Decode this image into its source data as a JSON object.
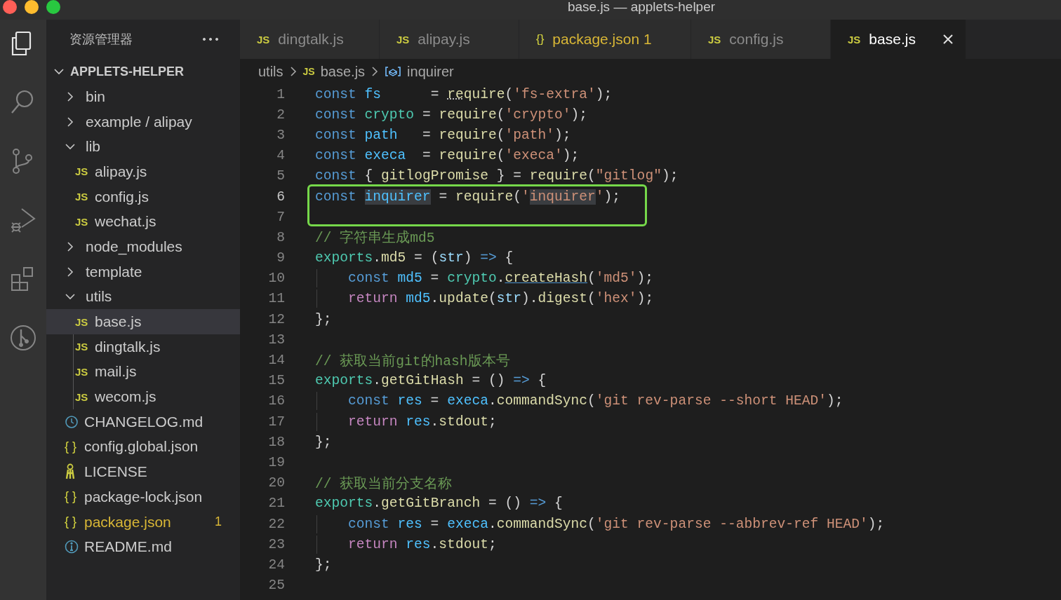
{
  "window": {
    "title": "base.js — applets-helper"
  },
  "activity_bar": [
    {
      "kind": "files",
      "selected": true
    },
    {
      "kind": "search",
      "selected": false
    },
    {
      "kind": "source-control",
      "selected": false
    },
    {
      "kind": "run-debug",
      "selected": false
    },
    {
      "kind": "extensions",
      "selected": false
    },
    {
      "kind": "git-graph",
      "selected": false
    }
  ],
  "explorer": {
    "title": "资源管理器",
    "root": {
      "label": "APPLETS-HELPER",
      "expanded": true,
      "children": [
        {
          "label": "bin",
          "kind": "folder",
          "expanded": false,
          "selected": false,
          "warning": false
        },
        {
          "label": "example / alipay",
          "kind": "folder",
          "expanded": false,
          "selected": false,
          "warning": false
        },
        {
          "label": "lib",
          "kind": "folder",
          "expanded": true,
          "selected": false,
          "warning": false,
          "children": [
            {
              "label": "alipay.js",
              "kind": "js",
              "icon": "JS",
              "selected": false,
              "warning": false
            },
            {
              "label": "config.js",
              "kind": "js",
              "icon": "JS",
              "selected": false,
              "warning": false
            },
            {
              "label": "wechat.js",
              "kind": "js",
              "icon": "JS",
              "selected": false,
              "warning": false
            }
          ]
        },
        {
          "label": "node_modules",
          "kind": "folder",
          "expanded": false,
          "selected": false,
          "warning": false
        },
        {
          "label": "template",
          "kind": "folder",
          "expanded": false,
          "selected": false,
          "warning": false
        },
        {
          "label": "utils",
          "kind": "folder",
          "expanded": true,
          "selected": false,
          "warning": false,
          "children": [
            {
              "label": "base.js",
              "kind": "js",
              "icon": "JS",
              "selected": true,
              "warning": false
            },
            {
              "label": "dingtalk.js",
              "kind": "js",
              "icon": "JS",
              "selected": false,
              "warning": false
            },
            {
              "label": "mail.js",
              "kind": "js",
              "icon": "JS",
              "selected": false,
              "warning": false
            },
            {
              "label": "wecom.js",
              "kind": "js",
              "icon": "JS",
              "selected": false,
              "warning": false
            }
          ]
        },
        {
          "label": "CHANGELOG.md",
          "kind": "changelog",
          "selected": false,
          "warning": false
        },
        {
          "label": "config.global.json",
          "kind": "json",
          "icon": "{ }",
          "selected": false,
          "warning": false
        },
        {
          "label": "LICENSE",
          "kind": "license",
          "selected": false,
          "warning": false
        },
        {
          "label": "package-lock.json",
          "kind": "json",
          "icon": "{ }",
          "selected": false,
          "warning": false
        },
        {
          "label": "package.json",
          "kind": "json",
          "icon": "{ }",
          "selected": false,
          "warning": true,
          "badge": "1"
        },
        {
          "label": "README.md",
          "kind": "readme",
          "selected": false,
          "warning": false
        }
      ]
    }
  },
  "tabs": [
    {
      "label": "dingtalk.js",
      "icon": "JS",
      "kind": "js",
      "selected": false,
      "warning": false
    },
    {
      "label": "alipay.js",
      "icon": "JS",
      "kind": "js",
      "selected": false,
      "warning": false
    },
    {
      "label": "package.json",
      "icon": "{}",
      "kind": "json",
      "selected": false,
      "warning": true,
      "badge": "1"
    },
    {
      "label": "config.js",
      "icon": "JS",
      "kind": "js",
      "selected": false,
      "warning": false
    },
    {
      "label": "base.js",
      "icon": "JS",
      "kind": "js",
      "selected": true,
      "warning": false
    }
  ],
  "breadcrumb": [
    {
      "label": "utils",
      "kind": "folder"
    },
    {
      "label": "base.js",
      "kind": "file",
      "icon": "JS"
    },
    {
      "label": "inquirer",
      "kind": "symbol"
    }
  ],
  "code": [
    {
      "number": "1",
      "current": false,
      "boxed": false,
      "indented": false,
      "tokens": [
        {
          "kind": "kw",
          "text": "const "
        },
        {
          "kind": "var",
          "text": "fs"
        },
        {
          "kind": "p",
          "text": "      = "
        },
        {
          "kind": "hint",
          "text": "re"
        },
        {
          "kind": "fn",
          "text": "quire"
        },
        {
          "kind": "p",
          "text": "("
        },
        {
          "kind": "str",
          "text": "'fs-extra'"
        },
        {
          "kind": "p",
          "text": ");"
        }
      ]
    },
    {
      "number": "2",
      "current": false,
      "boxed": false,
      "indented": false,
      "tokens": [
        {
          "kind": "kw",
          "text": "const "
        },
        {
          "kind": "mod",
          "text": "crypto"
        },
        {
          "kind": "p",
          "text": " = "
        },
        {
          "kind": "fn",
          "text": "require"
        },
        {
          "kind": "p",
          "text": "("
        },
        {
          "kind": "str",
          "text": "'crypto'"
        },
        {
          "kind": "p",
          "text": ");"
        }
      ]
    },
    {
      "number": "3",
      "current": false,
      "boxed": false,
      "indented": false,
      "tokens": [
        {
          "kind": "kw",
          "text": "const "
        },
        {
          "kind": "var",
          "text": "path"
        },
        {
          "kind": "p",
          "text": "   = "
        },
        {
          "kind": "fn",
          "text": "require"
        },
        {
          "kind": "p",
          "text": "("
        },
        {
          "kind": "str",
          "text": "'path'"
        },
        {
          "kind": "p",
          "text": ");"
        }
      ]
    },
    {
      "number": "4",
      "current": false,
      "boxed": false,
      "indented": false,
      "tokens": [
        {
          "kind": "kw",
          "text": "const "
        },
        {
          "kind": "var",
          "text": "execa"
        },
        {
          "kind": "p",
          "text": "  = "
        },
        {
          "kind": "fn",
          "text": "require"
        },
        {
          "kind": "p",
          "text": "("
        },
        {
          "kind": "str",
          "text": "'execa'"
        },
        {
          "kind": "p",
          "text": ");"
        }
      ]
    },
    {
      "number": "5",
      "current": false,
      "boxed": false,
      "indented": false,
      "tokens": [
        {
          "kind": "kw",
          "text": "const "
        },
        {
          "kind": "p",
          "text": "{ "
        },
        {
          "kind": "fn",
          "text": "gitlogPromise"
        },
        {
          "kind": "p",
          "text": " } = "
        },
        {
          "kind": "fn",
          "text": "require"
        },
        {
          "kind": "p",
          "text": "("
        },
        {
          "kind": "str",
          "text": "\"gitlog\""
        },
        {
          "kind": "p",
          "text": ");"
        }
      ]
    },
    {
      "number": "6",
      "current": true,
      "boxed": true,
      "indented": false,
      "tokens": [
        {
          "kind": "kw",
          "text": "const "
        },
        {
          "kind": "match",
          "text": "inquirer"
        },
        {
          "kind": "p",
          "text": " = "
        },
        {
          "kind": "fn",
          "text": "require"
        },
        {
          "kind": "p",
          "text": "("
        },
        {
          "kind": "str",
          "text": "'"
        },
        {
          "kind": "matchstr",
          "text": "inquirer"
        },
        {
          "kind": "str",
          "text": "'"
        },
        {
          "kind": "p",
          "text": ");"
        }
      ]
    },
    {
      "number": "7",
      "current": false,
      "boxed": true,
      "indented": false
    },
    {
      "number": "8",
      "current": false,
      "boxed": false,
      "indented": false,
      "tokens": [
        {
          "kind": "cm",
          "text": "// 字符串生成md5"
        }
      ]
    },
    {
      "number": "9",
      "current": false,
      "boxed": false,
      "indented": false,
      "tokens": [
        {
          "kind": "mod",
          "text": "exports"
        },
        {
          "kind": "p",
          "text": "."
        },
        {
          "kind": "fn",
          "text": "md5"
        },
        {
          "kind": "p",
          "text": " = ("
        },
        {
          "kind": "param",
          "text": "str"
        },
        {
          "kind": "p",
          "text": ") "
        },
        {
          "kind": "kw",
          "text": "=>"
        },
        {
          "kind": "p",
          "text": " {"
        }
      ]
    },
    {
      "number": "10",
      "current": false,
      "boxed": false,
      "indented": true,
      "tokens": [
        {
          "kind": "kw",
          "text": "const "
        },
        {
          "kind": "var",
          "text": "md5"
        },
        {
          "kind": "p",
          "text": " = "
        },
        {
          "kind": "mod",
          "text": "crypto"
        },
        {
          "kind": "p",
          "text": "."
        },
        {
          "kind": "link",
          "text": "createHash"
        },
        {
          "kind": "p",
          "text": "("
        },
        {
          "kind": "str",
          "text": "'md5'"
        },
        {
          "kind": "p",
          "text": ");"
        }
      ]
    },
    {
      "number": "11",
      "current": false,
      "boxed": false,
      "indented": true,
      "tokens": [
        {
          "kind": "ret",
          "text": "return "
        },
        {
          "kind": "var",
          "text": "md5"
        },
        {
          "kind": "p",
          "text": "."
        },
        {
          "kind": "fn",
          "text": "update"
        },
        {
          "kind": "p",
          "text": "("
        },
        {
          "kind": "param",
          "text": "str"
        },
        {
          "kind": "p",
          "text": ")."
        },
        {
          "kind": "fn",
          "text": "digest"
        },
        {
          "kind": "p",
          "text": "("
        },
        {
          "kind": "str",
          "text": "'hex'"
        },
        {
          "kind": "p",
          "text": ");"
        }
      ]
    },
    {
      "number": "12",
      "current": false,
      "boxed": false,
      "indented": false,
      "tokens": [
        {
          "kind": "p",
          "text": "};"
        }
      ]
    },
    {
      "number": "13",
      "current": false,
      "boxed": false,
      "indented": false
    },
    {
      "number": "14",
      "current": false,
      "boxed": false,
      "indented": false,
      "tokens": [
        {
          "kind": "cm",
          "text": "// 获取当前git的hash版本号"
        }
      ]
    },
    {
      "number": "15",
      "current": false,
      "boxed": false,
      "indented": false,
      "tokens": [
        {
          "kind": "mod",
          "text": "exports"
        },
        {
          "kind": "p",
          "text": "."
        },
        {
          "kind": "fn",
          "text": "getGitHash"
        },
        {
          "kind": "p",
          "text": " = () "
        },
        {
          "kind": "kw",
          "text": "=>"
        },
        {
          "kind": "p",
          "text": " {"
        }
      ]
    },
    {
      "number": "16",
      "current": false,
      "boxed": false,
      "indented": true,
      "tokens": [
        {
          "kind": "kw",
          "text": "const "
        },
        {
          "kind": "var",
          "text": "res"
        },
        {
          "kind": "p",
          "text": " = "
        },
        {
          "kind": "var",
          "text": "execa"
        },
        {
          "kind": "p",
          "text": "."
        },
        {
          "kind": "fn",
          "text": "commandSync"
        },
        {
          "kind": "p",
          "text": "("
        },
        {
          "kind": "str",
          "text": "'git rev-parse --short HEAD'"
        },
        {
          "kind": "p",
          "text": ");"
        }
      ]
    },
    {
      "number": "17",
      "current": false,
      "boxed": false,
      "indented": true,
      "tokens": [
        {
          "kind": "ret",
          "text": "return "
        },
        {
          "kind": "var",
          "text": "res"
        },
        {
          "kind": "p",
          "text": "."
        },
        {
          "kind": "fn",
          "text": "stdout"
        },
        {
          "kind": "p",
          "text": ";"
        }
      ]
    },
    {
      "number": "18",
      "current": false,
      "boxed": false,
      "indented": false,
      "tokens": [
        {
          "kind": "p",
          "text": "};"
        }
      ]
    },
    {
      "number": "19",
      "current": false,
      "boxed": false,
      "indented": false
    },
    {
      "number": "20",
      "current": false,
      "boxed": false,
      "indented": false,
      "tokens": [
        {
          "kind": "cm",
          "text": "// 获取当前分支名称"
        }
      ]
    },
    {
      "number": "21",
      "current": false,
      "boxed": false,
      "indented": false,
      "tokens": [
        {
          "kind": "mod",
          "text": "exports"
        },
        {
          "kind": "p",
          "text": "."
        },
        {
          "kind": "fn",
          "text": "getGitBranch"
        },
        {
          "kind": "p",
          "text": " = () "
        },
        {
          "kind": "kw",
          "text": "=>"
        },
        {
          "kind": "p",
          "text": " {"
        }
      ]
    },
    {
      "number": "22",
      "current": false,
      "boxed": false,
      "indented": true,
      "tokens": [
        {
          "kind": "kw",
          "text": "const "
        },
        {
          "kind": "var",
          "text": "res"
        },
        {
          "kind": "p",
          "text": " = "
        },
        {
          "kind": "var",
          "text": "execa"
        },
        {
          "kind": "p",
          "text": "."
        },
        {
          "kind": "fn",
          "text": "commandSync"
        },
        {
          "kind": "p",
          "text": "("
        },
        {
          "kind": "str",
          "text": "'git rev-parse --abbrev-ref HEAD'"
        },
        {
          "kind": "p",
          "text": ");"
        }
      ]
    },
    {
      "number": "23",
      "current": false,
      "boxed": false,
      "indented": true,
      "tokens": [
        {
          "kind": "ret",
          "text": "return "
        },
        {
          "kind": "var",
          "text": "res"
        },
        {
          "kind": "p",
          "text": "."
        },
        {
          "kind": "fn",
          "text": "stdout"
        },
        {
          "kind": "p",
          "text": ";"
        }
      ]
    },
    {
      "number": "24",
      "current": false,
      "boxed": false,
      "indented": false,
      "tokens": [
        {
          "kind": "p",
          "text": "};"
        }
      ]
    },
    {
      "number": "25",
      "current": false,
      "boxed": false,
      "indented": false
    }
  ]
}
